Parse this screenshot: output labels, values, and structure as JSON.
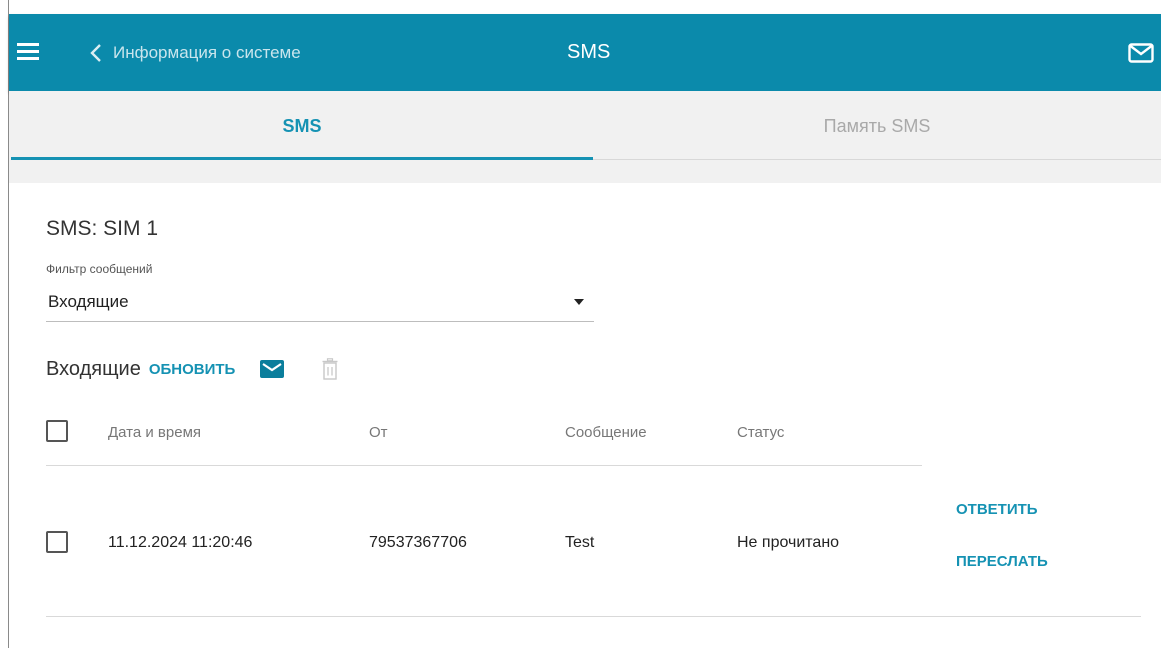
{
  "header": {
    "back_label": "Информация о системе",
    "title": "SMS"
  },
  "tabs": [
    {
      "label": "SMS",
      "active": true
    },
    {
      "label": "Память SMS",
      "active": false
    }
  ],
  "sim_title": "SMS: SIM 1",
  "filter": {
    "label": "Фильтр сообщений",
    "value": "Входящие"
  },
  "section": {
    "title": "Входящие",
    "refresh_label": "ОБНОВИТЬ"
  },
  "table": {
    "columns": [
      "Дата и время",
      "От",
      "Сообщение",
      "Статус"
    ],
    "rows": [
      {
        "date": "11.12.2024 11:20:46",
        "from": "79537367706",
        "message": "Test",
        "status": "Не прочитано",
        "actions": [
          "ОТВЕТИТЬ",
          "ПЕРЕСЛАТЬ"
        ]
      }
    ]
  },
  "colors": {
    "header_bg": "#0b8aab",
    "accent": "#1592b3"
  }
}
